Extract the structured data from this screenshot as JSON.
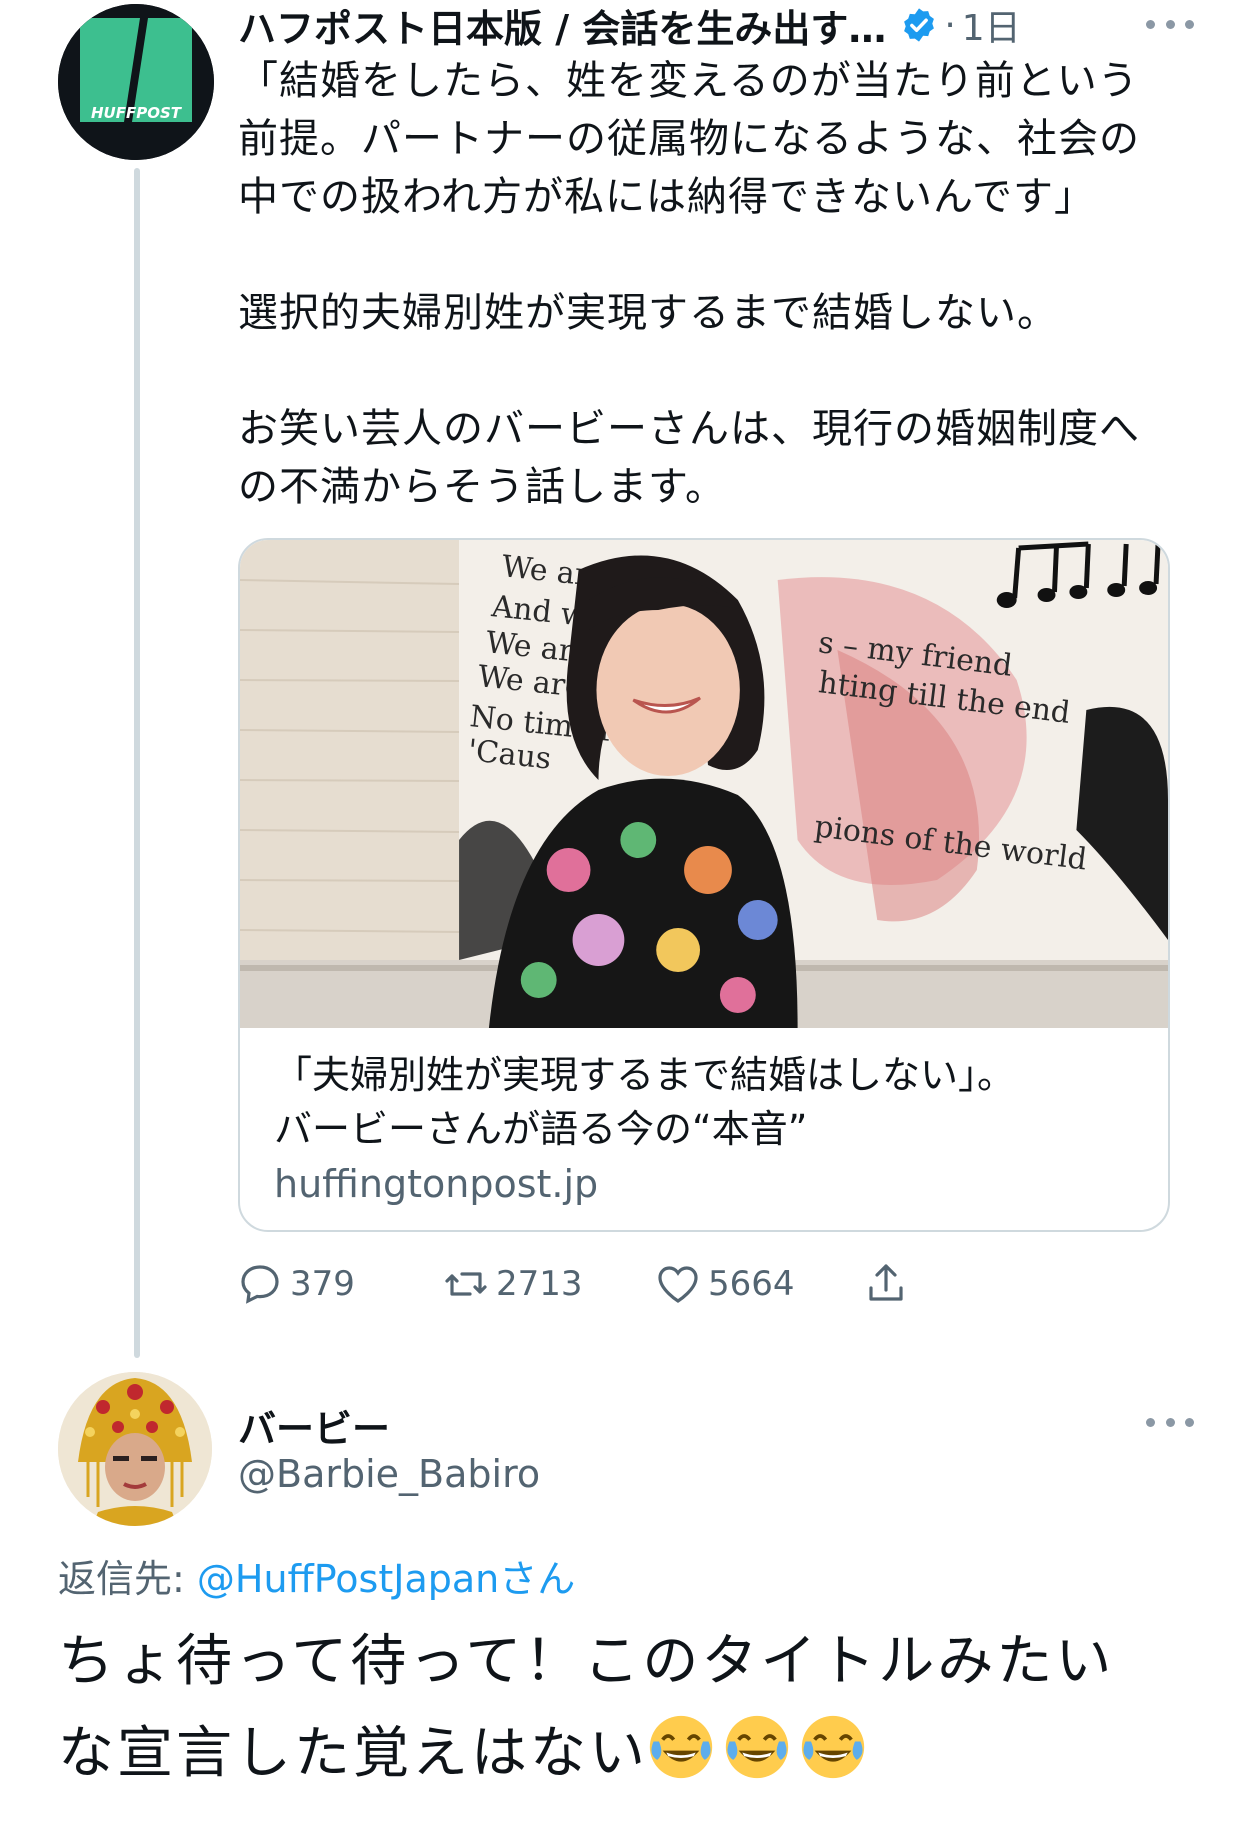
{
  "tweet1": {
    "name": "ハフポスト日本版 / 会話を生み出す…",
    "verified_icon": "verified-badge-icon",
    "dot": "·",
    "time": "1日",
    "avatar_text": "HUFFPOST",
    "body": [
      "「結婚をしたら、姓を変えるのが当たり前という",
      "前提。パートナーの従属物になるような、社会の",
      "中での扱われ方が私には納得できないんです」",
      "",
      "選択的夫婦別姓が実現するまで結婚しない。",
      "",
      "お笑い芸人のバービーさんは、現行の婚姻制度へ",
      "の不満からそう話します。"
    ],
    "card": {
      "image_text": [
        "We are t",
        "And we",
        "We are",
        "We are",
        "No time fo",
        "'Caus",
        "s – my friend",
        "hting till the end",
        "pions of the world"
      ],
      "title_line1": "「夫婦別姓が実現するまで結婚はしない」。",
      "title_line2": "バービーさんが語る今の“本音”",
      "domain": "huffingtonpost.jp"
    },
    "actions": {
      "replies": "379",
      "retweets": "2713",
      "likes": "5664"
    }
  },
  "tweet2": {
    "name": "バービー",
    "handle": "@Barbie_Babiro",
    "reply_prefix": "返信先: ",
    "reply_target": "@HuffPostJapanさん",
    "body_line1": "ちょ待って待って！このタイトルみたい",
    "body_line2": "な宣言した覚えはない"
  },
  "colors": {
    "text": "#0f1419",
    "muted": "#536471",
    "link": "#1d9bf0",
    "border": "#cfd9de",
    "huffpost_green": "#3dbf8f"
  }
}
